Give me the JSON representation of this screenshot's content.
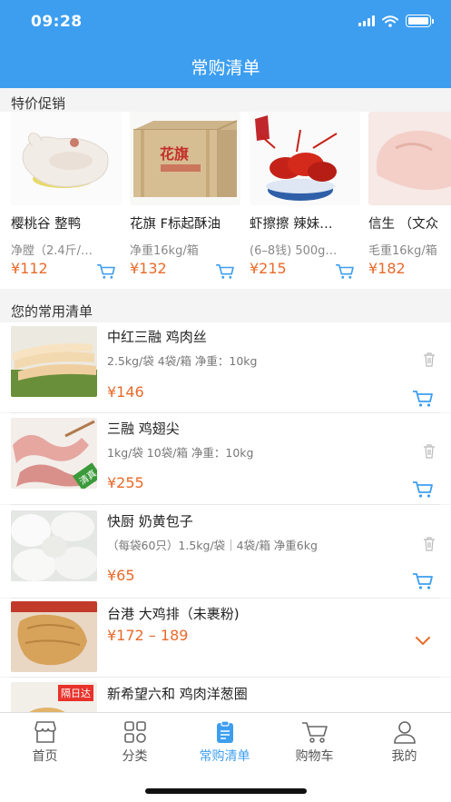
{
  "status_bar": {
    "time": "09:28"
  },
  "header": {
    "title": "常购清单"
  },
  "promo": {
    "title": "特价促销",
    "items": [
      {
        "name": "樱桃谷 整鸭",
        "spec": "净膛（2.4斤/…",
        "price": "¥112"
      },
      {
        "name": "花旗 F标起酥油",
        "spec": "净重16kg/箱",
        "price": "¥132",
        "box_label": "花旗"
      },
      {
        "name": "虾擦擦 辣妹…",
        "spec": "(6–8钱) 500g…",
        "price": "¥215"
      },
      {
        "name": "信生 （文众",
        "spec": "毛重16kg/箱",
        "price": "¥182"
      }
    ]
  },
  "common_list": {
    "title": "您的常用清单",
    "items": [
      {
        "name": "中红三融 鸡肉丝",
        "spec": "2.5kg/袋 4袋/箱 净重：10kg",
        "price": "¥146"
      },
      {
        "name": "三融 鸡翅尖",
        "spec": "1kg/袋 10袋/箱 净重：10kg",
        "price": "¥255",
        "tag": "清真"
      },
      {
        "name": "快厨 奶黄包子",
        "spec": "（每袋60只）1.5kg/袋｜4袋/箱 净重6kg",
        "price": "¥65"
      },
      {
        "name": "台港 大鸡排（未裹粉)",
        "price": "¥172 – 189"
      },
      {
        "name": "新希望六和 鸡肉洋葱圈",
        "badge": "隔日达"
      }
    ]
  },
  "tabbar": {
    "tabs": [
      {
        "label": "首页",
        "icon": "store-icon"
      },
      {
        "label": "分类",
        "icon": "grid-icon"
      },
      {
        "label": "常购清单",
        "icon": "clipboard-icon",
        "active": true
      },
      {
        "label": "购物车",
        "icon": "cart-icon"
      },
      {
        "label": "我的",
        "icon": "user-icon"
      }
    ]
  },
  "colors": {
    "primary": "#3d9ef0",
    "price": "#e86a2a",
    "badge": "#e8322b"
  }
}
